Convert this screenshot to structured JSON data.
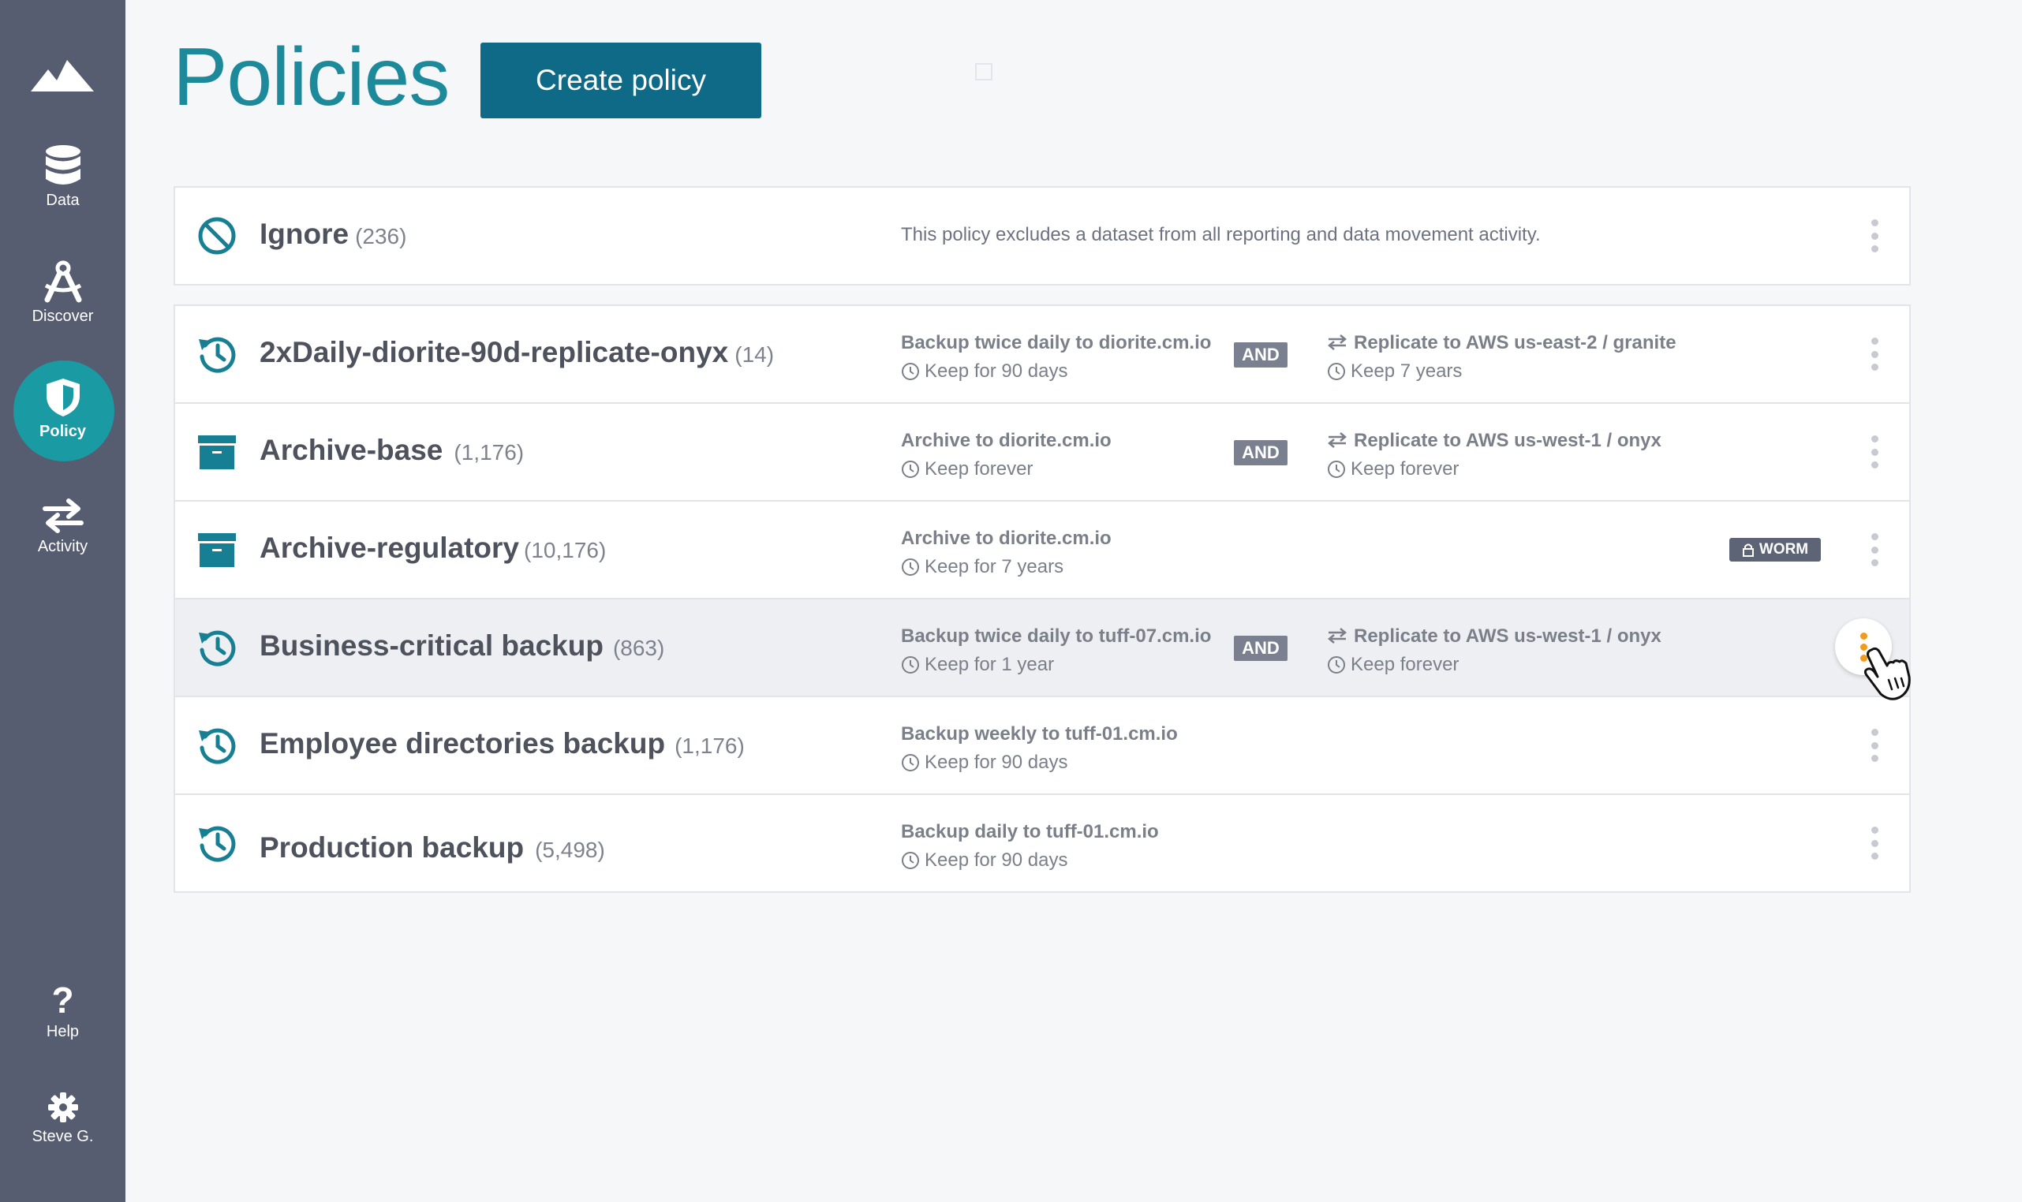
{
  "sidebar": {
    "logo": "mountain-logo",
    "items": [
      {
        "label": "Data",
        "icon": "database-icon"
      },
      {
        "label": "Discover",
        "icon": "compass-icon"
      },
      {
        "label": "Policy",
        "icon": "shield-icon",
        "active": true
      },
      {
        "label": "Activity",
        "icon": "arrows-exchange-icon"
      }
    ],
    "bottom": [
      {
        "label": "Help",
        "icon": "question-icon"
      },
      {
        "label": "Steve G.",
        "icon": "gear-icon"
      }
    ],
    "colors": {
      "background": "#565d71",
      "active": "#1a9aa3"
    }
  },
  "header": {
    "title": "Policies",
    "create_button": "Create policy"
  },
  "ignore_policy": {
    "name": "Ignore",
    "count": "(236)",
    "description": "This policy excludes a dataset from all reporting and data movement activity.",
    "icon": "ban-icon"
  },
  "policies": [
    {
      "name": "2xDaily-diorite-90d-replicate-onyx",
      "count": "(14)",
      "icon": "history-icon",
      "rule1": {
        "main": "Backup twice daily to diorite.cm.io",
        "retention": "Keep for 90 days"
      },
      "and": "AND",
      "rule2": {
        "main": "Replicate to AWS us-east-2 / granite",
        "retention": "Keep 7 years"
      }
    },
    {
      "name": "Archive-base",
      "count": "(1,176)",
      "icon": "archive-box-icon",
      "rule1": {
        "main": "Archive to diorite.cm.io",
        "retention": "Keep forever"
      },
      "and": "AND",
      "rule2": {
        "main": "Replicate to AWS us-west-1 / onyx",
        "retention": "Keep forever"
      }
    },
    {
      "name": "Archive-regulatory",
      "count": "(10,176)",
      "icon": "archive-box-icon",
      "rule1": {
        "main": "Archive to diorite.cm.io",
        "retention": "Keep for 7 years"
      },
      "badge": "WORM"
    },
    {
      "name": "Business-critical backup",
      "count": "(863)",
      "icon": "history-icon",
      "rule1": {
        "main": "Backup twice daily to tuff-07.cm.io",
        "retention": "Keep for 1 year"
      },
      "and": "AND",
      "rule2": {
        "main": "Replicate to AWS us-west-1 / onyx",
        "retention": "Keep forever"
      },
      "highlighted": true
    },
    {
      "name": "Employee directories backup",
      "count": "(1,176)",
      "icon": "history-icon",
      "rule1": {
        "main": "Backup weekly to tuff-01.cm.io",
        "retention": "Keep for 90 days"
      }
    },
    {
      "name": "Production backup",
      "count": "(5,498)",
      "icon": "history-icon",
      "rule1": {
        "main": "Backup daily to tuff-01.cm.io",
        "retention": "Keep for 90 days"
      }
    }
  ],
  "colors": {
    "accent": "#1d8a9c",
    "button": "#0f6a87",
    "kebab_active": "#f19b1d"
  }
}
